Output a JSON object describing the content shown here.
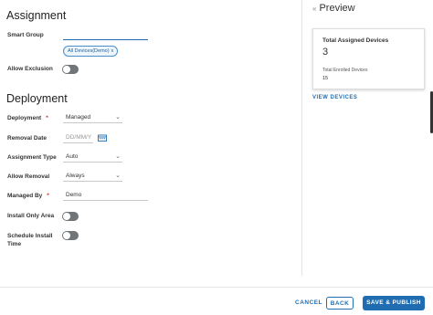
{
  "assignment": {
    "title": "Assignment",
    "smart_group_label": "Smart Group",
    "smart_group_value": "",
    "chip_label": "All Devices(Demo)",
    "chip_remove": "x",
    "allow_exclusion_label": "Allow Exclusion",
    "allow_exclusion_on": false
  },
  "deployment": {
    "title": "Deployment",
    "deployment_label": "Deployment",
    "deployment_value": "Managed",
    "removal_date_label": "Removal Date",
    "removal_date_placeholder": "DD/MM/Y",
    "assignment_type_label": "Assignment Type",
    "assignment_type_value": "Auto",
    "allow_removal_label": "Allow Removal",
    "allow_removal_value": "Always",
    "managed_by_label": "Managed By",
    "managed_by_value": "Demo",
    "install_only_area_label": "Install Only Area",
    "install_only_area_on": false,
    "schedule_install_label_1": "Schedule Install",
    "schedule_install_label_2": "Time",
    "schedule_install_on": false,
    "required_mark": "*"
  },
  "preview": {
    "collapse_glyph": "«",
    "title": "Preview",
    "total_assigned_label": "Total Assigned Devices",
    "total_assigned_value": "3",
    "total_enrolled_label": "Total Enrolled Devices",
    "total_enrolled_value": "15",
    "view_devices": "VIEW DEVICES"
  },
  "footer": {
    "cancel": "CANCEL",
    "back": "BACK",
    "save_publish": "SAVE & PUBLISH"
  },
  "colors": {
    "accent": "#1f6db0",
    "toggle_off": "#6f7579",
    "required": "#c0392b"
  },
  "icons": {
    "calendar": "calendar-icon",
    "chevron": "chevron-down-icon",
    "collapse": "double-chevron-left-icon"
  }
}
